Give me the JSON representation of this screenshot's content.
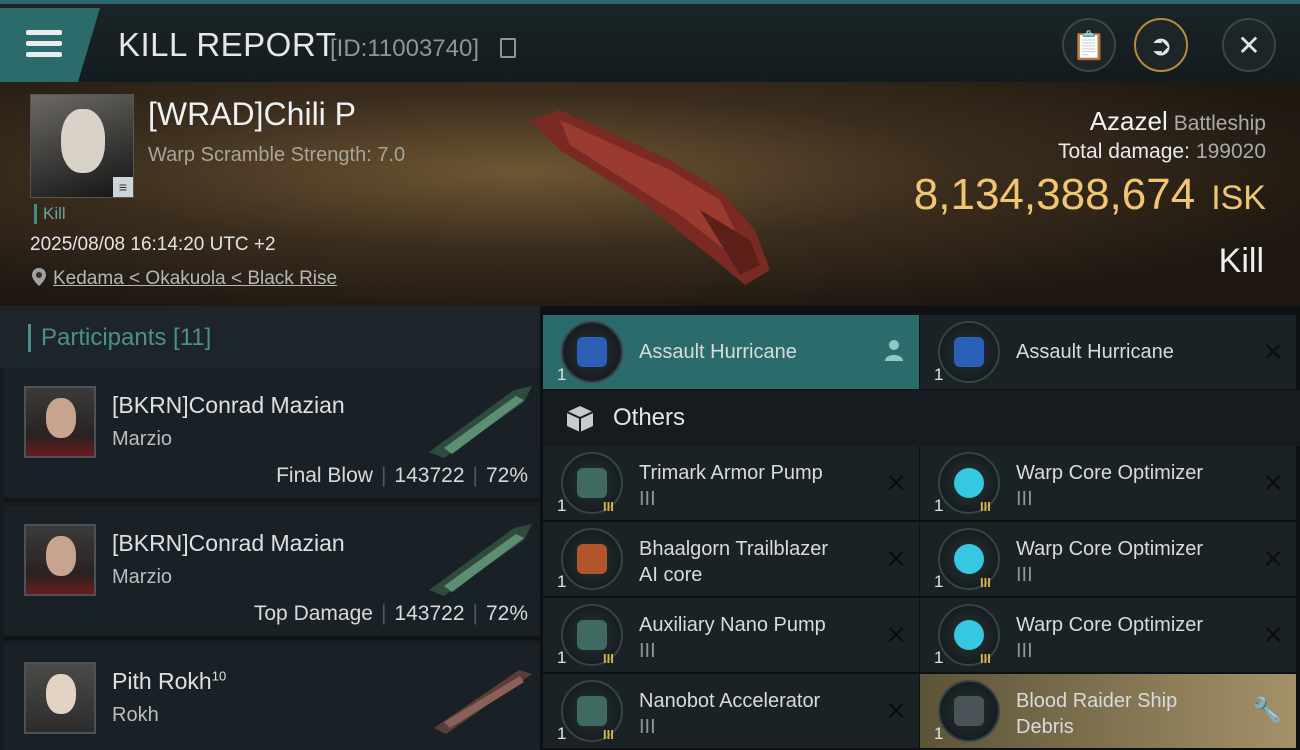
{
  "header": {
    "title": "KILL REPORT",
    "id_text": "[ID:11003740]"
  },
  "victim": {
    "name": "[WRAD]Chili P",
    "subtitle": "Warp Scramble Strength: 7.0",
    "kill_tag": "Kill",
    "timestamp": "2025/08/08 16:14:20 UTC +2",
    "location": "Kedama < Okakuola < Black Rise",
    "ship": "Azazel",
    "ship_class": "Battleship",
    "total_damage_label": "Total damage:",
    "total_damage": "199020",
    "isk_value": "8,134,388,674",
    "isk_unit": "ISK",
    "result": "Kill"
  },
  "participants": {
    "title": "Participants [11]",
    "rows": [
      {
        "name": "[BKRN]Conrad Mazian",
        "ship": "Marzio",
        "role": "Final Blow",
        "damage": "143722",
        "percent": "72%"
      },
      {
        "name": "[BKRN]Conrad Mazian",
        "ship": "Marzio",
        "role": "Top Damage",
        "damage": "143722",
        "percent": "72%"
      },
      {
        "name": "Pith Rokh",
        "name_sup": "10",
        "ship": "Rokh",
        "role": "",
        "damage": "",
        "percent": ""
      }
    ]
  },
  "items": {
    "top": [
      {
        "name": "Assault Hurricane",
        "qty": "1"
      },
      {
        "name": "Assault Hurricane",
        "qty": "1"
      }
    ],
    "others_label": "Others",
    "list": [
      {
        "line1": "Trimark Armor Pump",
        "line2": "III",
        "qty": "1",
        "tier": "III"
      },
      {
        "line1": "Warp Core Optimizer",
        "line2": "III",
        "qty": "1",
        "tier": "III"
      },
      {
        "line1": "Bhaalgorn Trailblazer",
        "line2": "AI core",
        "qty": "1",
        "tier": ""
      },
      {
        "line1": "Warp Core Optimizer",
        "line2": "III",
        "qty": "1",
        "tier": "III"
      },
      {
        "line1": "Auxiliary Nano Pump",
        "line2": "III",
        "qty": "1",
        "tier": "III"
      },
      {
        "line1": "Warp Core Optimizer",
        "line2": "III",
        "qty": "1",
        "tier": "III"
      },
      {
        "line1": "Nanobot Accelerator",
        "line2": "III",
        "qty": "1",
        "tier": "III"
      },
      {
        "line1": "Blood Raider Ship",
        "line2": "Debris",
        "qty": "1",
        "tier": ""
      }
    ]
  },
  "colors": {
    "accent_teal": "#2c6b6b",
    "isk_gold": "#f1c672",
    "tier_gold": "#d9b44a"
  },
  "icons": {
    "menu": "hamburger-icon",
    "copy": "copy-icon",
    "report": "clipboard-icon",
    "share": "share-icon",
    "close": "close-icon",
    "location": "map-pin-icon",
    "others": "cube-icon",
    "pilot": "person-icon",
    "wrench": "wrench-icon"
  }
}
